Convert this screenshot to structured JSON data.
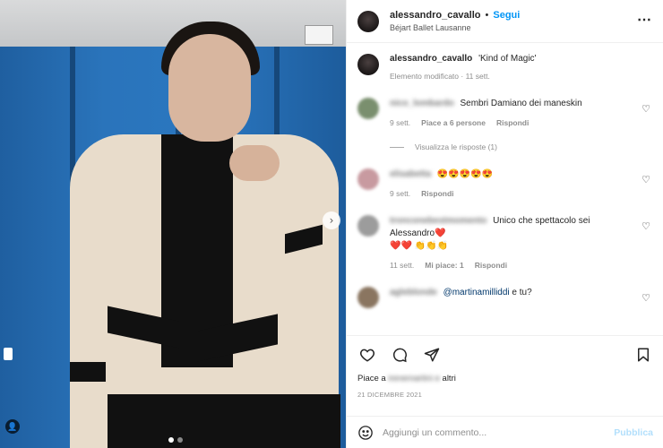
{
  "post": {
    "username": "alessandro_cavallo",
    "separator": "•",
    "follow_label": "Segui",
    "location": "Béjart Ballet Lausanne",
    "more_icon": "⋯"
  },
  "caption": {
    "username": "alessandro_cavallo",
    "text": "'Kind of Magic'",
    "edited": "Elemento modificato · 11 sett."
  },
  "comments": [
    {
      "user": "nico_lombardo",
      "text": "Sembri Damiano dei maneskin",
      "time": "9 sett.",
      "likes": "Piace a 6 persone",
      "reply": "Rispondi",
      "view_replies": "Visualizza le risposte (1)",
      "avatar_color": "#7a8f6e"
    },
    {
      "user": "elisabetta",
      "text": "😍😍😍😍😍",
      "time": "9 sett.",
      "reply": "Rispondi",
      "avatar_color": "#c89aa0"
    },
    {
      "user": "tronconebestmomento",
      "text": "Unico che spettacolo sei Alessandro❤️",
      "text2": "❤️❤️ 👏👏👏",
      "time": "11 sett.",
      "likes": "Mi piace: 1",
      "reply": "Rispondi",
      "avatar_color": "#9c9c9c"
    },
    {
      "user": "agleblonde",
      "mention": "@martinamilliddi",
      "text": "e tu?",
      "avatar_color": "#8a7560"
    }
  ],
  "actions": {
    "likes_prefix": "Piace a",
    "likes_blur": "irenemartini e",
    "likes_suffix": "altri",
    "date": "21 DICEMBRE 2021"
  },
  "add_comment": {
    "placeholder": "Aggiungi un commento...",
    "publish_label": "Pubblica"
  },
  "colors": {
    "accent": "#0095f6",
    "publish_disabled": "#b2dffc",
    "muted": "#8e8e8e"
  }
}
